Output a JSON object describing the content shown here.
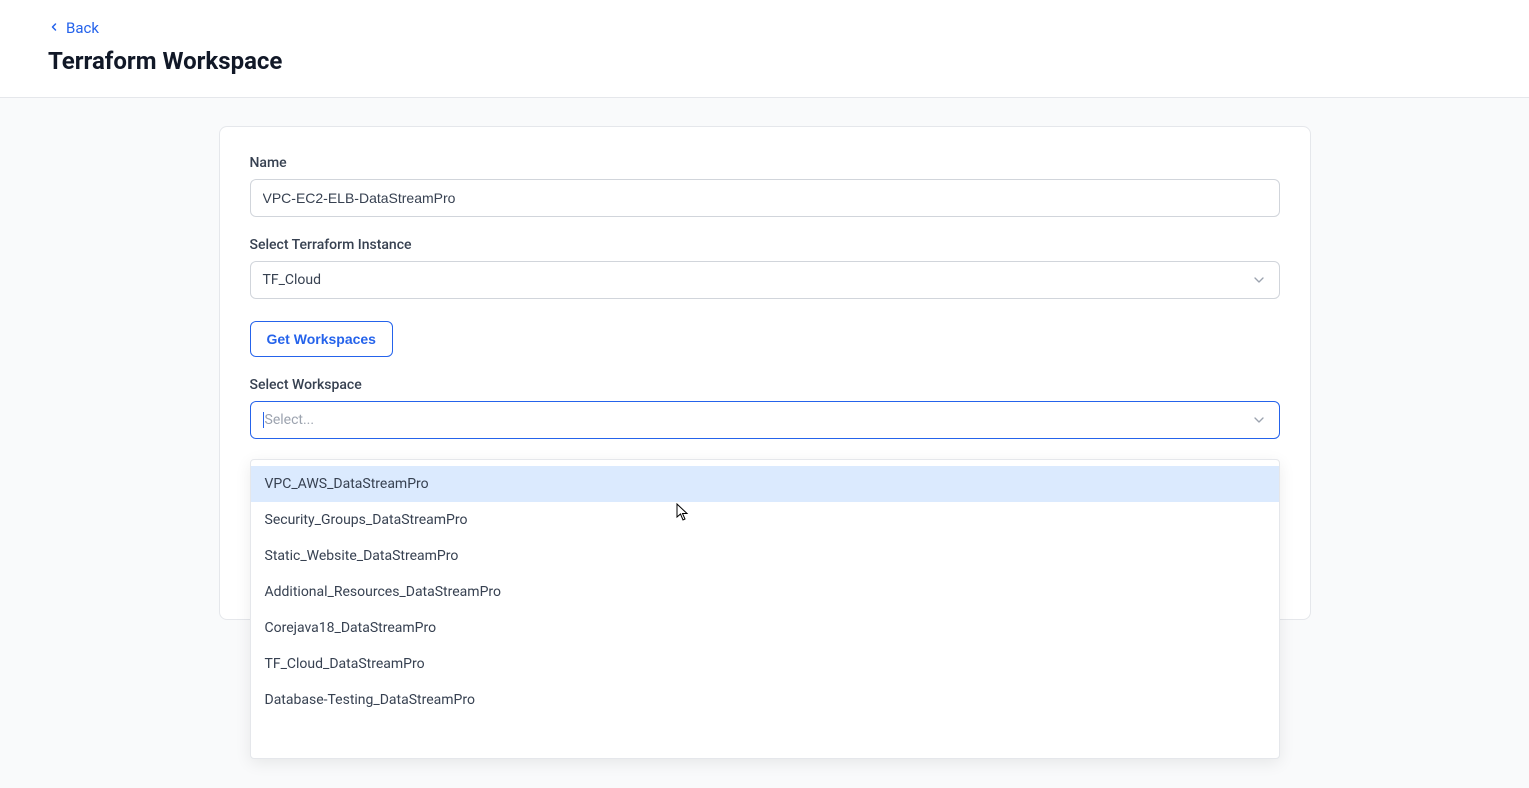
{
  "header": {
    "back_label": "Back",
    "page_title": "Terraform Workspace"
  },
  "form": {
    "name_label": "Name",
    "name_value": "VPC-EC2-ELB-DataStreamPro",
    "instance_label": "Select Terraform Instance",
    "instance_value": "TF_Cloud",
    "get_workspaces_label": "Get Workspaces",
    "workspace_label": "Select Workspace",
    "workspace_placeholder": "Select..."
  },
  "dropdown": {
    "items": [
      "VPC_AWS_DataStreamPro",
      "Security_Groups_DataStreamPro",
      "Static_Website_DataStreamPro",
      "Additional_Resources_DataStreamPro",
      "Corejava18_DataStreamPro",
      "TF_Cloud_DataStreamPro",
      "Database-Testing_DataStreamPro"
    ],
    "highlighted_index": 0
  }
}
